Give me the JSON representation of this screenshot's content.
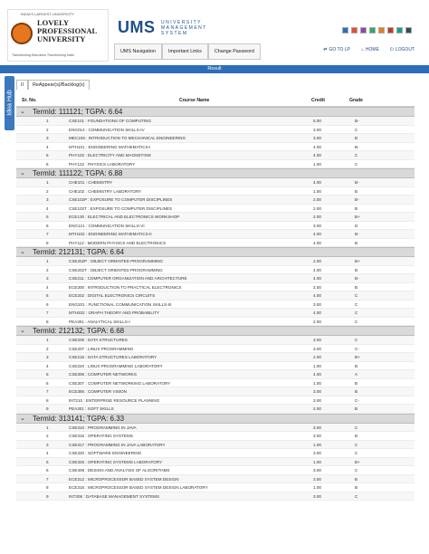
{
  "header": {
    "logo_topline": "INDIA'S LARGEST UNIVERSITY",
    "logo_name": [
      "LOVELY",
      "PROFESSIONAL",
      "UNIVERSITY"
    ],
    "logo_tagline": "Transforming Education Transforming India",
    "brand": "UMS",
    "brand_sub": [
      "UNIVERSITY",
      "MANAGEMENT SYSTEM"
    ],
    "util_colors": [
      "#2e6eb8",
      "#e74c3c",
      "#8e44ad",
      "#27ae60",
      "#e67e22",
      "#c0392b",
      "#16a085",
      "#34495e"
    ],
    "links": [
      {
        "icon": "goto-icon",
        "label": "GO TO LP"
      },
      {
        "icon": "home-icon",
        "label": "HOME"
      },
      {
        "icon": "logout-icon",
        "label": "LOGOUT"
      }
    ]
  },
  "nav": [
    "UMS Navigation",
    "Important Links",
    "Change Password"
  ],
  "result_title": "Result",
  "idea_hub": "Idea Hub",
  "tabs": [
    "II",
    "ReAppear(s)/Backlog(s)"
  ],
  "columns": {
    "sr": "Sr. No.",
    "course": "Course Name",
    "credit": "Credit",
    "grade": "Grade"
  },
  "terms": [
    {
      "label": "TermId: 111121; TGPA: 6.64",
      "rows": [
        {
          "no": "1",
          "course": "CSE101 : FOUNDATIONS OF COMPUTING",
          "credit": "5.00",
          "grade": "B-"
        },
        {
          "no": "2",
          "course": "ENG014 : COMMUNICATION SKILLS-IV",
          "credit": "3.00",
          "grade": "C"
        },
        {
          "no": "3",
          "course": "MEC106 : INTRODUCTION TO MECHANICAL ENGINEERING",
          "credit": "3.00",
          "grade": "B"
        },
        {
          "no": "4",
          "course": "MTH101 : ENGINEERING MATHEMATICS-I",
          "credit": "4.00",
          "grade": "B-"
        },
        {
          "no": "5",
          "course": "PHY102 : ELECTRICITY AND MAGNETISM",
          "credit": "4.00",
          "grade": "C"
        },
        {
          "no": "6",
          "course": "PHY122 : PHYSICS LABORATORY",
          "credit": "1.00",
          "grade": "C"
        }
      ]
    },
    {
      "label": "TermId: 111122; TGPA: 6.88",
      "rows": [
        {
          "no": "1",
          "course": "CHE101 : CHEMISTRY",
          "credit": "4.00",
          "grade": "B-"
        },
        {
          "no": "2",
          "course": "CHE102 : CHEMISTRY LABORATORY",
          "credit": "1.00",
          "grade": "B"
        },
        {
          "no": "3",
          "course": "CSE102P : EXPOSURE TO COMPUTER DISCIPLINES",
          "credit": "2.00",
          "grade": "B-"
        },
        {
          "no": "4",
          "course": "CSE102T : EXPOSURE TO COMPUTER DISCIPLINES",
          "credit": "2.00",
          "grade": "B"
        },
        {
          "no": "5",
          "course": "ECE130 : ELECTRICAL AND ELECTRONICS WORKSHOP",
          "credit": "2.00",
          "grade": "B+"
        },
        {
          "no": "6",
          "course": "ENG121 : COMMUNICATION SKILLS-VI",
          "credit": "3.00",
          "grade": "D"
        },
        {
          "no": "7",
          "course": "MTH102 : ENGINEERING MATHEMATICS-II",
          "credit": "4.00",
          "grade": "B-"
        },
        {
          "no": "8",
          "course": "PHY112 : MODERN PHYSICS AND ELECTRONICS",
          "credit": "4.00",
          "grade": "B"
        }
      ]
    },
    {
      "label": "TermId: 212131; TGPA: 6.64",
      "rows": [
        {
          "no": "1",
          "course": "CSE202P : OBJECT ORIENTED PROGRAMMING",
          "credit": "2.00",
          "grade": "B+"
        },
        {
          "no": "2",
          "course": "CSE202T : OBJECT ORIENTED PROGRAMMING",
          "credit": "4.00",
          "grade": "B"
        },
        {
          "no": "3",
          "course": "CSE211 : COMPUTER ORGANIZATION AND ARCHITECTURE",
          "credit": "4.00",
          "grade": "B-"
        },
        {
          "no": "4",
          "course": "ECE300 : INTRODUCTION TO PRACTICAL ELECTRONICS",
          "credit": "2.00",
          "grade": "B"
        },
        {
          "no": "5",
          "course": "ECE202 : DIGITAL ELECTRONICS CIRCUITS",
          "credit": "4.00",
          "grade": "C"
        },
        {
          "no": "6",
          "course": "ENG201 : FUNCTIONAL COMMUNICATION SKILLS-III",
          "credit": "3.00",
          "grade": "C"
        },
        {
          "no": "7",
          "course": "MTH202 : GRAPH THEORY AND PROBABILITY",
          "credit": "4.00",
          "grade": "C"
        },
        {
          "no": "8",
          "course": "PEA301 : ANALYTICAL SKILLS-I",
          "credit": "2.00",
          "grade": "C"
        }
      ]
    },
    {
      "label": "TermId: 212132; TGPA: 6.68",
      "rows": [
        {
          "no": "1",
          "course": "CSE205 : DATA STRUCTURES",
          "credit": "3.00",
          "grade": "C"
        },
        {
          "no": "2",
          "course": "CSE207 : LINUX PROGRAMMING",
          "credit": "3.00",
          "grade": "C-"
        },
        {
          "no": "3",
          "course": "CSE215 : DATA STRUCTURES LABORATORY",
          "credit": "2.00",
          "grade": "B+"
        },
        {
          "no": "4",
          "course": "CSE220 : LINUX PROGRAMMING LABORATORY",
          "credit": "1.00",
          "grade": "B"
        },
        {
          "no": "5",
          "course": "CSE306 : COMPUTER NETWORKS",
          "credit": "4.00",
          "grade": "A"
        },
        {
          "no": "6",
          "course": "CSE307 : COMPUTER NETWORKING LABORATORY",
          "credit": "1.00",
          "grade": "B"
        },
        {
          "no": "7",
          "course": "ECE385 : COMPUTER VISION",
          "credit": "3.00",
          "grade": "B"
        },
        {
          "no": "8",
          "course": "INT210 : ENTERPRISE RESOURCE PLANNING",
          "credit": "3.00",
          "grade": "C-"
        },
        {
          "no": "9",
          "course": "PEA301 : SOFT SKILLS",
          "credit": "2.00",
          "grade": "B"
        }
      ]
    },
    {
      "label": "TermId: 313141; TGPA: 6.33",
      "rows": [
        {
          "no": "1",
          "course": "CSE310 : PROGRAMMING IN JAVA",
          "credit": "3.00",
          "grade": "C"
        },
        {
          "no": "2",
          "course": "CSE316 : OPERATING SYSTEMS",
          "credit": "3.00",
          "grade": "B"
        },
        {
          "no": "3",
          "course": "CSE317 : PROGRAMMING IN JAVA LABORATORY",
          "credit": "1.00",
          "grade": "C"
        },
        {
          "no": "4",
          "course": "CSE320 : SOFTWARE ENGINEERING",
          "credit": "3.00",
          "grade": "C"
        },
        {
          "no": "5",
          "course": "CSE325 : OPERATING SYSTEMS LABORATORY",
          "credit": "1.00",
          "grade": "B+"
        },
        {
          "no": "6",
          "course": "CSE408 : DESIGN AND ANALYSIS OF ALGORITHMS",
          "credit": "3.00",
          "grade": "C"
        },
        {
          "no": "7",
          "course": "ECE312 : MICROPROCESSOR BASED SYSTEM DESIGN",
          "credit": "3.00",
          "grade": "B"
        },
        {
          "no": "8",
          "course": "ECE315 : MICROPROCESSOR BASED SYSTEM DESIGN LABORATORY",
          "credit": "1.00",
          "grade": "B"
        },
        {
          "no": "9",
          "course": "INT306 : DATABASE MANAGEMENT SYSTEMS",
          "credit": "3.00",
          "grade": "C"
        }
      ]
    }
  ]
}
